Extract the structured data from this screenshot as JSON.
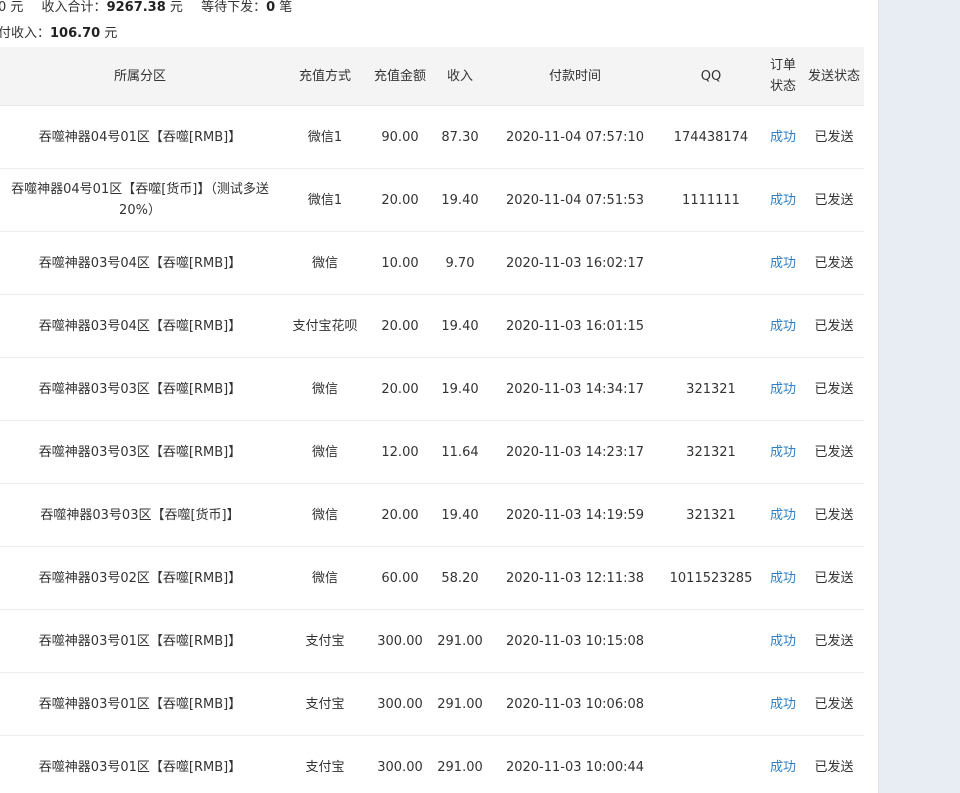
{
  "summary": {
    "line1_lead": "0 元",
    "income_label": "收入合计：",
    "income_value": "9267.38",
    "income_unit": "元",
    "pending_label": "等待下发：",
    "pending_value": "0",
    "pending_unit": "笔",
    "line2_label": "付收入：",
    "line2_value": "106.70",
    "line2_unit": "元"
  },
  "table": {
    "headers": {
      "zone": "所属分区",
      "method": "充值方式",
      "amount": "充值金额",
      "income": "收入",
      "time": "付款时间",
      "qq": "QQ",
      "order_status": "订单状态",
      "send_status": "发送状态"
    },
    "rows": [
      {
        "zone": "吞噬神器04号01区【吞噬[RMB]】",
        "method": "微信1",
        "amount": "90.00",
        "income": "87.30",
        "time": "2020-11-04 07:57:10",
        "qq": "174438174",
        "order_status": "成功",
        "send_status": "已发送"
      },
      {
        "zone": "吞噬神器04号01区【吞噬[货币]】（测试多送20%）",
        "method": "微信1",
        "amount": "20.00",
        "income": "19.40",
        "time": "2020-11-04 07:51:53",
        "qq": "1111111",
        "order_status": "成功",
        "send_status": "已发送"
      },
      {
        "zone": "吞噬神器03号04区【吞噬[RMB]】",
        "method": "微信",
        "amount": "10.00",
        "income": "9.70",
        "time": "2020-11-03 16:02:17",
        "qq": "",
        "order_status": "成功",
        "send_status": "已发送"
      },
      {
        "zone": "吞噬神器03号04区【吞噬[RMB]】",
        "method": "支付宝花呗",
        "amount": "20.00",
        "income": "19.40",
        "time": "2020-11-03 16:01:15",
        "qq": "",
        "order_status": "成功",
        "send_status": "已发送"
      },
      {
        "zone": "吞噬神器03号03区【吞噬[RMB]】",
        "method": "微信",
        "amount": "20.00",
        "income": "19.40",
        "time": "2020-11-03 14:34:17",
        "qq": "321321",
        "order_status": "成功",
        "send_status": "已发送"
      },
      {
        "zone": "吞噬神器03号03区【吞噬[RMB]】",
        "method": "微信",
        "amount": "12.00",
        "income": "11.64",
        "time": "2020-11-03 14:23:17",
        "qq": "321321",
        "order_status": "成功",
        "send_status": "已发送"
      },
      {
        "zone": "吞噬神器03号03区【吞噬[货币]】",
        "method": "微信",
        "amount": "20.00",
        "income": "19.40",
        "time": "2020-11-03 14:19:59",
        "qq": "321321",
        "order_status": "成功",
        "send_status": "已发送"
      },
      {
        "zone": "吞噬神器03号02区【吞噬[RMB]】",
        "method": "微信",
        "amount": "60.00",
        "income": "58.20",
        "time": "2020-11-03 12:11:38",
        "qq": "1011523285",
        "order_status": "成功",
        "send_status": "已发送"
      },
      {
        "zone": "吞噬神器03号01区【吞噬[RMB]】",
        "method": "支付宝",
        "amount": "300.00",
        "income": "291.00",
        "time": "2020-11-03 10:15:08",
        "qq": "",
        "order_status": "成功",
        "send_status": "已发送"
      },
      {
        "zone": "吞噬神器03号01区【吞噬[RMB]】",
        "method": "支付宝",
        "amount": "300.00",
        "income": "291.00",
        "time": "2020-11-03 10:06:08",
        "qq": "",
        "order_status": "成功",
        "send_status": "已发送"
      },
      {
        "zone": "吞噬神器03号01区【吞噬[RMB]】",
        "method": "支付宝",
        "amount": "300.00",
        "income": "291.00",
        "time": "2020-11-03 10:00:44",
        "qq": "",
        "order_status": "成功",
        "send_status": "已发送"
      }
    ]
  },
  "colors": {
    "header_bg": "#f4f4f4",
    "success_link": "#2e7fc4",
    "right_panel_bg": "#e8edf3"
  }
}
